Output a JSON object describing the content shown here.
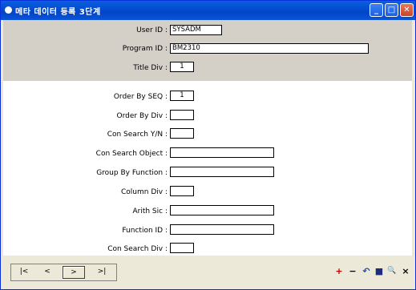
{
  "window": {
    "title": "메타 데이터 등록 3단계"
  },
  "header": {
    "user_id": {
      "label": "User ID :",
      "value": "SYSADM"
    },
    "program_id": {
      "label": "Program ID :",
      "value": "BM2310"
    },
    "title_div": {
      "label": "Title Div :",
      "value": "1"
    }
  },
  "body": {
    "order_by_seq": {
      "label": "Order By SEQ :",
      "value": "1"
    },
    "order_by_div": {
      "label": "Order By Div :",
      "value": ""
    },
    "con_search_yn": {
      "label": "Con Search Y/N :",
      "value": ""
    },
    "con_search_object": {
      "label": "Con Search Object :",
      "value": ""
    },
    "group_by_function": {
      "label": "Group By Function :",
      "value": ""
    },
    "column_div": {
      "label": "Column Div :",
      "value": ""
    },
    "arith_sic": {
      "label": "Arith Sic :",
      "value": ""
    },
    "function_id": {
      "label": "Function ID :",
      "value": ""
    },
    "con_search_div": {
      "label": "Con Search Div :",
      "value": ""
    }
  },
  "footer": {
    "nav": {
      "first": "|<",
      "prev": "<",
      "next": ">",
      "last": ">|"
    },
    "actions": {
      "add": "+",
      "remove": "−",
      "undo": "↶",
      "save": "■",
      "find": "🔍",
      "close": "×"
    }
  }
}
